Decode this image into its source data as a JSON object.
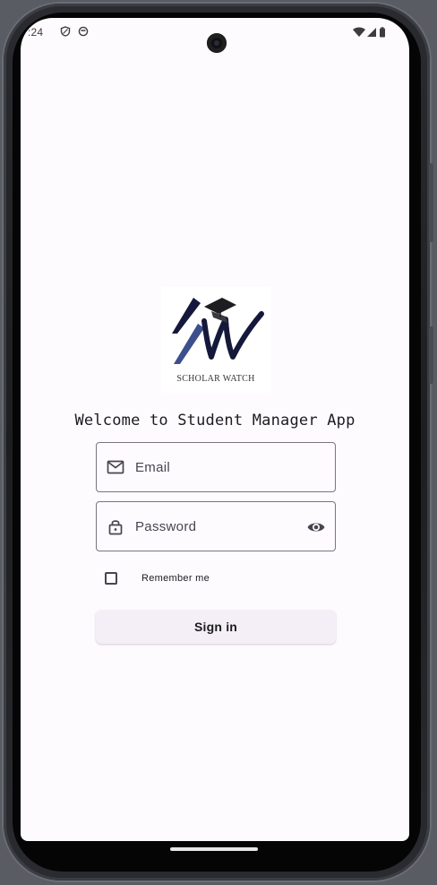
{
  "status_bar": {
    "time": ":24",
    "left_icons": [
      "shield-icon",
      "circle-status-icon"
    ],
    "right_icons": [
      "wifi-icon",
      "signal-icon",
      "battery-icon"
    ]
  },
  "logo": {
    "caption": "SCHOLAR WATCH",
    "icon": "scholar-watch-logo"
  },
  "welcome_text": "Welcome to Student Manager App",
  "email_field": {
    "placeholder": "Email",
    "value": "",
    "icon": "mail-icon"
  },
  "password_field": {
    "placeholder": "Password",
    "value": "",
    "icon": "lock-icon",
    "trailing_icon": "eye-icon"
  },
  "remember_me": {
    "label": "Remember me",
    "checked": false
  },
  "signin_button": {
    "label": "Sign in"
  },
  "colors": {
    "screen_background": "#fefbff",
    "outline": "#79747e",
    "button_background": "#f4eff6",
    "text": "#1c1b1f",
    "logo_navy": "#14183a",
    "logo_blue": "#3d4f8c"
  }
}
